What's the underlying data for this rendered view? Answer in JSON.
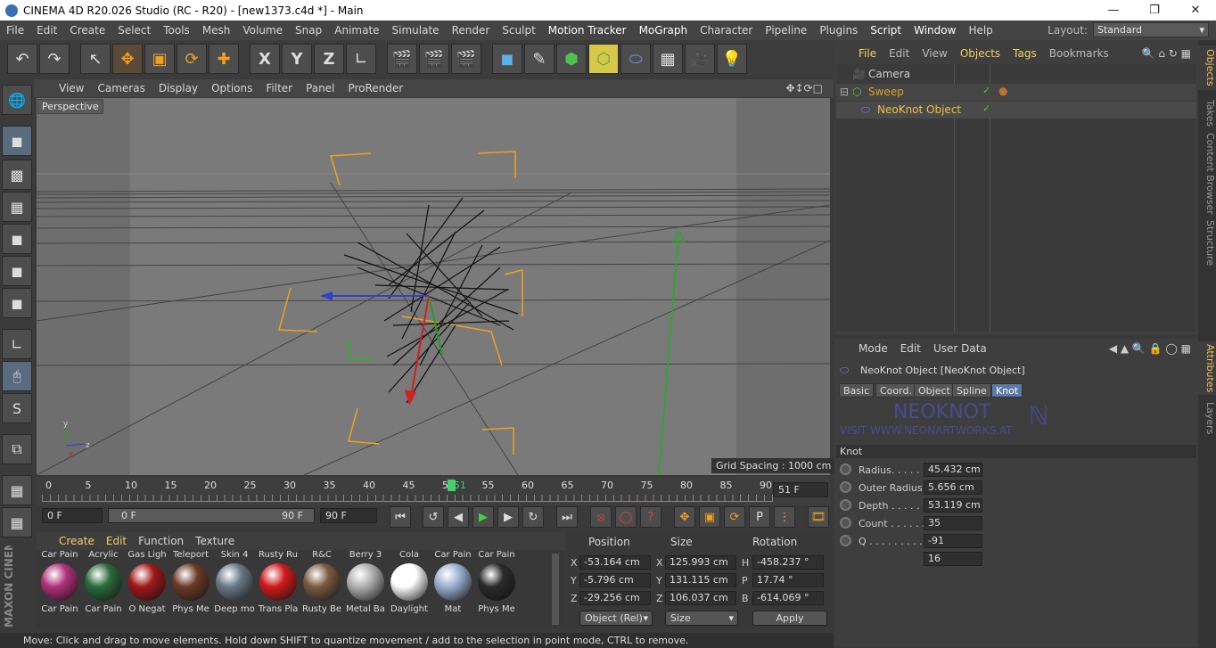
{
  "window": {
    "title": "CINEMA 4D R20.026 Studio (RC - R20) - [new1373.c4d *] - Main"
  },
  "menubar": {
    "items": [
      "File",
      "Edit",
      "Create",
      "Select",
      "Tools",
      "Mesh",
      "Volume",
      "Snap",
      "Animate",
      "Simulate",
      "Render",
      "Sculpt",
      "Motion Tracker",
      "MoGraph",
      "Character",
      "Pipeline",
      "Plugins",
      "Script",
      "Window",
      "Help"
    ],
    "layout_label": "Layout:",
    "layout_value": "Standard"
  },
  "viewport": {
    "menu": [
      "View",
      "Cameras",
      "Display",
      "Options",
      "Filter",
      "Panel",
      "ProRender"
    ],
    "label": "Perspective",
    "grid_spacing": "Grid Spacing : 1000 cm"
  },
  "timeline": {
    "ticks": [
      "0",
      "5",
      "10",
      "15",
      "20",
      "25",
      "30",
      "35",
      "40",
      "45",
      "50",
      "51",
      "55",
      "60",
      "65",
      "70",
      "75",
      "80",
      "85",
      "90"
    ],
    "current_frame": "51 F"
  },
  "animbar": {
    "start": "0 F",
    "range_start": "0 F",
    "range_end": "90 F",
    "end": "90 F"
  },
  "materials": {
    "menu": [
      "Create",
      "Edit",
      "Function",
      "Texture"
    ],
    "top_row": [
      "Car Pain",
      "Acrylic",
      "Gas Ligh",
      "Teleport",
      "Skin 4",
      "Rusty Ru",
      "R&C",
      "Berry 3",
      "Cola",
      "Car Pain",
      "Car Pain"
    ],
    "bottom_row": [
      "Car Pain",
      "Car Pain",
      "O Negat",
      "Phys Me",
      "Deep mo",
      "Trans Pla",
      "Rusty Be",
      "Metal Ba",
      "Daylight",
      "Mat",
      "Phys Me"
    ],
    "colors": [
      "#b0307a",
      "#2a6b3a",
      "#a01818",
      "#6b3a28",
      "#6a7a88",
      "#d01a1a",
      "#7a5a40",
      "#b0b0b0",
      "#ffffff",
      "#9ab0d0",
      "#2a2a2a"
    ]
  },
  "coords": {
    "headers": {
      "position": "Position",
      "size": "Size",
      "rotation": "Rotation"
    },
    "rows": [
      {
        "axis": "X",
        "pos": "-53.164 cm",
        "saxis": "X",
        "size": "125.993 cm",
        "raxis": "H",
        "rot": "-458.237 °"
      },
      {
        "axis": "Y",
        "pos": "-5.796 cm",
        "saxis": "Y",
        "size": "131.115 cm",
        "raxis": "P",
        "rot": "17.74 °"
      },
      {
        "axis": "Z",
        "pos": "-29.256 cm",
        "saxis": "Z",
        "size": "106.037 cm",
        "raxis": "B",
        "rot": "-614.069 °"
      }
    ],
    "mode": "Object (Rel)",
    "size_mode": "Size",
    "apply": "Apply"
  },
  "status": "Move: Click and drag to move elements. Hold down SHIFT to quantize movement / add to the selection in point mode, CTRL to remove.",
  "objects_panel": {
    "menu": [
      "File",
      "Edit",
      "View",
      "Objects",
      "Tags",
      "Bookmarks"
    ],
    "items": [
      {
        "name": "Camera",
        "color": "#d0d0d0"
      },
      {
        "name": "Sweep",
        "color": "#e0a020"
      },
      {
        "name": "NeoKnot Object",
        "color": "#f0c040"
      }
    ]
  },
  "attributes": {
    "menu": [
      "Mode",
      "Edit",
      "User Data"
    ],
    "object_title": "NeoKnot Object [NeoKnot Object]",
    "tabs": [
      "Basic",
      "Coord.",
      "Object",
      "Spline",
      "Knot"
    ],
    "active_tab": "Knot",
    "logo_text": "NEOKNOT",
    "logo_url": "VISIT WWW.NEONARTWORKS.AT",
    "section": "Knot",
    "params": [
      {
        "label": "Radius. . . . . .",
        "value": "45.432 cm"
      },
      {
        "label": "Outer Radius",
        "value": "5.656 cm"
      },
      {
        "label": "Depth . . . . . .",
        "value": "53.119 cm"
      },
      {
        "label": "Count . . . . . .",
        "value": "35"
      },
      {
        "label": "Q . . . . . . . . . .",
        "value": "-91"
      },
      {
        "label": "",
        "value": "16"
      }
    ]
  },
  "side_tabs": [
    "Objects",
    "Takes",
    "Content Browser",
    "Structure",
    "Attributes",
    "Layers"
  ],
  "maxon_brand": "MAXON CINEMA 4D"
}
